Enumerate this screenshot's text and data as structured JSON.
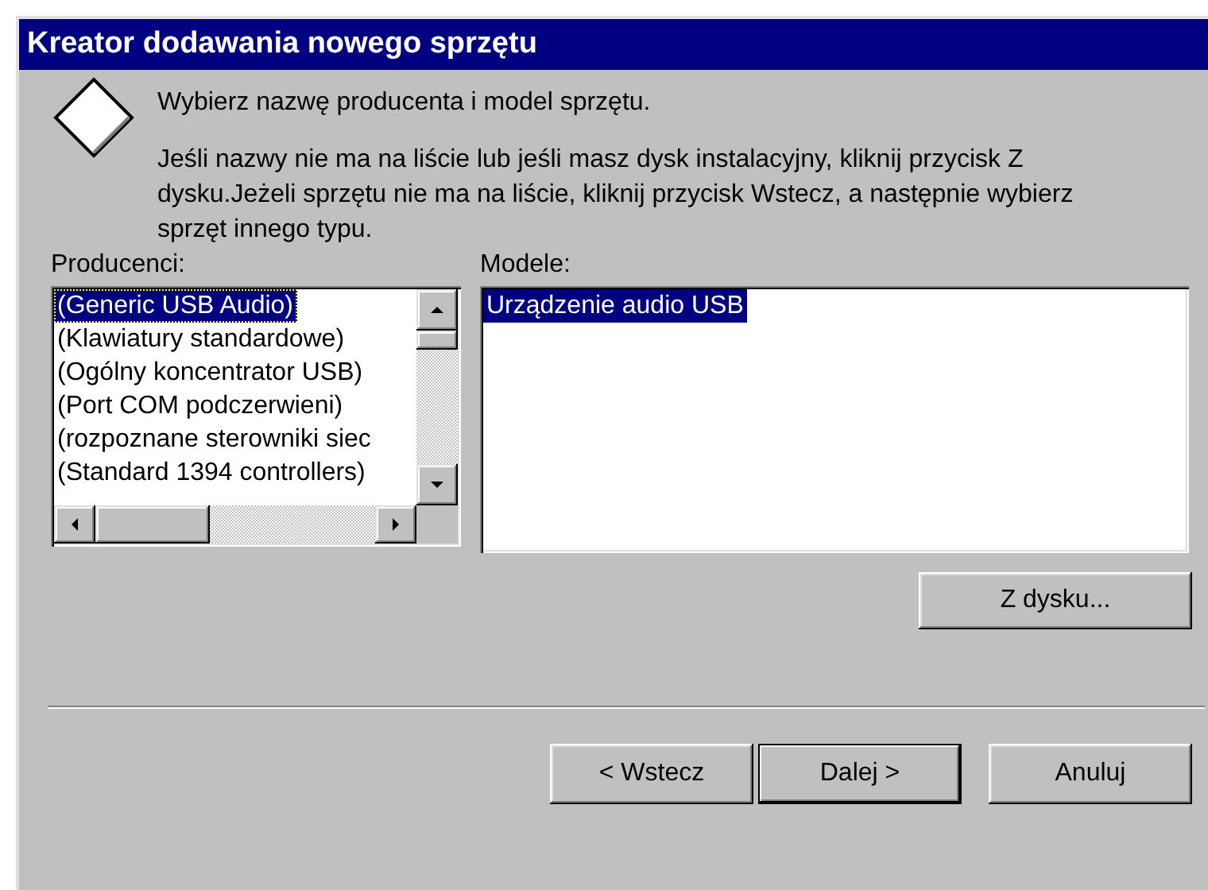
{
  "window": {
    "title": "Kreator dodawania nowego sprzętu"
  },
  "header": {
    "heading": "Wybierz nazwę producenta i model sprzętu.",
    "description": "Jeśli nazwy nie ma na liście lub jeśli masz dysk instalacyjny, kliknij przycisk Z dysku.Jeżeli sprzętu nie ma na liście, kliknij przycisk Wstecz, a następnie wybierz sprzęt innego typu."
  },
  "manufacturers": {
    "label": "Producenci:",
    "items": [
      {
        "label": "(Generic USB Audio)",
        "selected": true
      },
      {
        "label": "(Klawiatury standardowe)",
        "selected": false
      },
      {
        "label": "(Ogólny koncentrator USB)",
        "selected": false
      },
      {
        "label": "(Port COM podczerwieni)",
        "selected": false
      },
      {
        "label": "(rozpoznane sterowniki siec",
        "selected": false
      },
      {
        "label": "(Standard 1394 controllers)",
        "selected": false
      }
    ]
  },
  "models": {
    "label": "Modele:",
    "items": [
      {
        "label": "Urządzenie audio USB",
        "selected": true
      }
    ]
  },
  "disk_button": {
    "label": "Z dysku..."
  },
  "buttons": [
    {
      "label": "< Wstecz",
      "default": false
    },
    {
      "label": "Dalej >",
      "default": true
    },
    {
      "label": "Anuluj",
      "default": false
    }
  ]
}
